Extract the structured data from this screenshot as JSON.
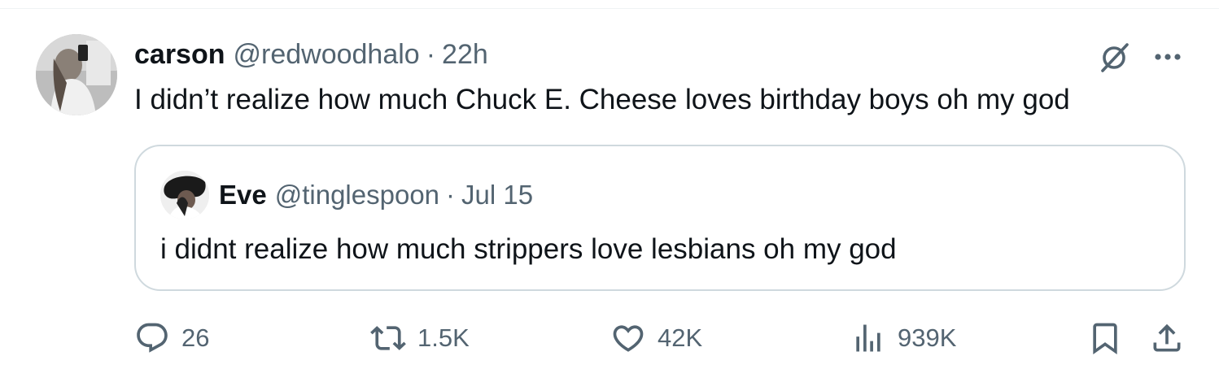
{
  "tweet": {
    "author": {
      "name": "carson",
      "handle": "@redwoodhalo",
      "separator": "·",
      "time": "22h"
    },
    "text": "I didn’t realize how much Chuck E. Cheese loves birthday boys oh my god",
    "quoted": {
      "author": {
        "name": "Eve",
        "handle": "@tinglespoon",
        "separator": "·",
        "time": "Jul 15"
      },
      "text": "i didnt realize how much strippers love lesbians oh my god"
    },
    "stats": {
      "replies": "26",
      "reposts": "1.5K",
      "likes": "42K",
      "views": "939K"
    },
    "icons": {
      "grok": "grok-icon",
      "more": "more-icon",
      "reply": "reply-icon",
      "repost": "repost-icon",
      "like": "heart-icon",
      "views": "views-icon",
      "bookmark": "bookmark-icon",
      "share": "share-icon"
    },
    "colors": {
      "text": "#0f1419",
      "secondary": "#536471",
      "border": "#cfd9de"
    }
  }
}
